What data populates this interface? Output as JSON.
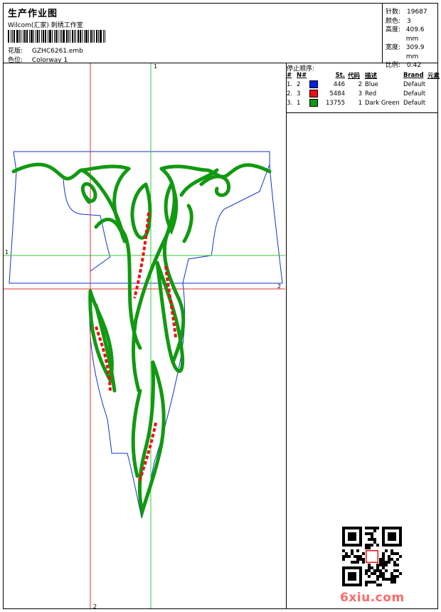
{
  "header": {
    "title": "生产作业图",
    "software": "Wilcom(汇家) 刺绣工作室",
    "design_label": "花版:",
    "design_value": "GZHC6261.emb",
    "colorway_label": "色位:",
    "colorway_value": "Colorway 1"
  },
  "stats": [
    {
      "label": "针数:",
      "value": "19687"
    },
    {
      "label": "颜色:",
      "value": "3"
    },
    {
      "label": "高度:",
      "value": "409.6 mm"
    },
    {
      "label": "宽度:",
      "value": "309.9 mm"
    },
    {
      "label": "比例:",
      "value": "0.42"
    }
  ],
  "stop_sequence": {
    "title": "停止顺序:",
    "headers": [
      "#",
      "N#",
      "St.",
      "代码",
      "描述",
      "Brand",
      "元素"
    ],
    "rows": [
      {
        "idx": "1.",
        "n": "2",
        "color": "#0022dd",
        "st": "446",
        "code": "2",
        "desc": "Blue",
        "brand": "Default"
      },
      {
        "idx": "2.",
        "n": "3",
        "color": "#ee1111",
        "st": "5484",
        "code": "3",
        "desc": "Red",
        "brand": "Default"
      },
      {
        "idx": "3.",
        "n": "1",
        "color": "#119911",
        "st": "13755",
        "code": "1",
        "desc": "Dark Green",
        "brand": "Default"
      }
    ]
  },
  "guides": {
    "green_top_label": "1",
    "green_left_label": "1",
    "red_right_label": "2",
    "red_bottom_label": "2"
  },
  "design_colors": {
    "outline": "#1133cc",
    "leaf": "#119911",
    "accent": "#ee1111",
    "guide_red": "#dd3333",
    "guide_green": "#33cc33"
  },
  "watermark": "6xiu.com"
}
